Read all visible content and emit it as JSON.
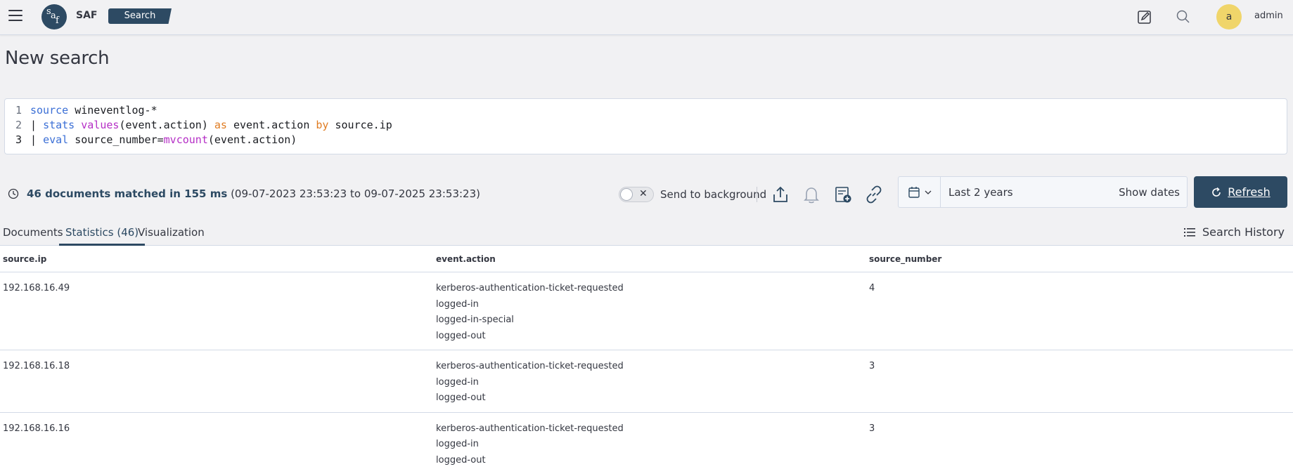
{
  "header": {
    "brand": "SAF",
    "breadcrumb": "Search",
    "user_initial": "a",
    "username": "admin",
    "icons": [
      "menu-icon",
      "edit-icon",
      "search-icon"
    ]
  },
  "page_title": "New search",
  "query": {
    "line_numbers": [
      "1",
      "2",
      "3"
    ],
    "lines": [
      [
        {
          "t": "source",
          "c": "kw-blue"
        },
        {
          "t": " wineventlog-*",
          "c": "tx"
        }
      ],
      [
        {
          "t": "| ",
          "c": "tx"
        },
        {
          "t": "stats",
          "c": "kw-blue"
        },
        {
          "t": " ",
          "c": "tx"
        },
        {
          "t": "values",
          "c": "kw-mag"
        },
        {
          "t": "(event.action) ",
          "c": "tx"
        },
        {
          "t": "as",
          "c": "kw-orange"
        },
        {
          "t": " event.action ",
          "c": "tx"
        },
        {
          "t": "by",
          "c": "kw-orange"
        },
        {
          "t": " source.ip",
          "c": "tx"
        }
      ],
      [
        {
          "t": "| ",
          "c": "tx"
        },
        {
          "t": "eval",
          "c": "kw-blue"
        },
        {
          "t": " source_number=",
          "c": "tx"
        },
        {
          "t": "mvcount",
          "c": "kw-mag"
        },
        {
          "t": "(event.action)",
          "c": "tx"
        }
      ]
    ]
  },
  "status": {
    "matched": "46 documents matched in 155 ms",
    "range": "(09-07-2023 23:53:23 to 09-07-2025 23:53:23)",
    "background_label": "Send to background",
    "tools": [
      "share-icon",
      "bell-icon",
      "add-report-icon",
      "link-icon"
    ]
  },
  "date_picker": {
    "range": "Last 2 years",
    "show_dates": "Show dates"
  },
  "refresh_label": "Refresh",
  "tabs": [
    "Documents",
    "Statistics (46)",
    "Visualization"
  ],
  "search_history": "Search History",
  "table": {
    "columns": [
      "source.ip",
      "event.action",
      "source_number"
    ],
    "rows": [
      {
        "ip": "192.168.16.49",
        "actions": [
          "kerberos-authentication-ticket-requested",
          "logged-in",
          "logged-in-special",
          "logged-out"
        ],
        "number": "4"
      },
      {
        "ip": "192.168.16.18",
        "actions": [
          "kerberos-authentication-ticket-requested",
          "logged-in",
          "logged-out"
        ],
        "number": "3"
      },
      {
        "ip": "192.168.16.16",
        "actions": [
          "kerberos-authentication-ticket-requested",
          "logged-in",
          "logged-out"
        ],
        "number": "3"
      }
    ]
  },
  "colors": {
    "primary": "#2d4a63",
    "avatar": "#f0d56a",
    "background": "#f1f1f3"
  }
}
